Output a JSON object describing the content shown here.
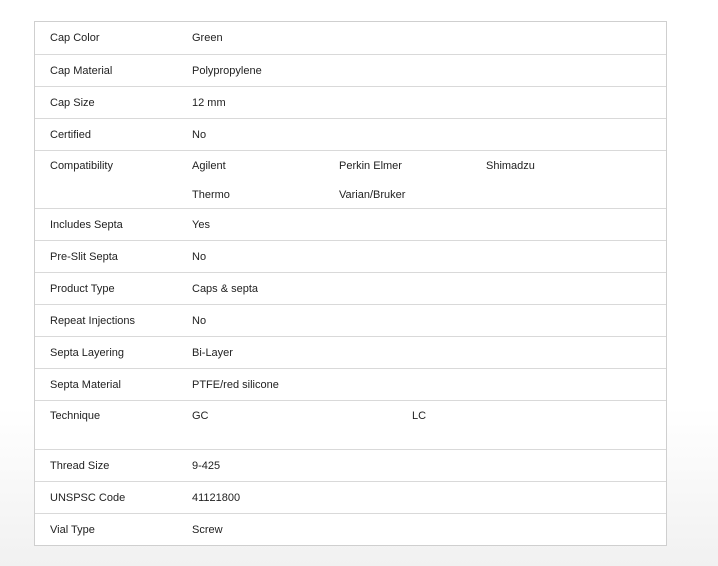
{
  "specs": {
    "cap_color": {
      "label": "Cap Color",
      "value": "Green"
    },
    "cap_material": {
      "label": "Cap Material",
      "value": "Polypropylene"
    },
    "cap_size": {
      "label": "Cap Size",
      "value": "12 mm"
    },
    "certified": {
      "label": "Certified",
      "value": "No"
    },
    "compatibility": {
      "label": "Compatibility",
      "values": [
        "Agilent",
        "Perkin Elmer",
        "Shimadzu",
        "Thermo",
        "Varian/Bruker"
      ]
    },
    "includes_septa": {
      "label": "Includes Septa",
      "value": "Yes"
    },
    "pre_slit_septa": {
      "label": "Pre-Slit Septa",
      "value": "No"
    },
    "product_type": {
      "label": "Product Type",
      "value": "Caps & septa"
    },
    "repeat_injections": {
      "label": "Repeat Injections",
      "value": "No"
    },
    "septa_layering": {
      "label": "Septa Layering",
      "value": "Bi-Layer"
    },
    "septa_material": {
      "label": "Septa Material",
      "value": "PTFE/red silicone"
    },
    "technique": {
      "label": "Technique",
      "values": [
        "GC",
        "LC"
      ]
    },
    "thread_size": {
      "label": "Thread Size",
      "value": "9-425"
    },
    "unspsc_code": {
      "label": "UNSPSC Code",
      "value": "41121800"
    },
    "vial_type": {
      "label": "Vial Type",
      "value": "Screw"
    }
  }
}
